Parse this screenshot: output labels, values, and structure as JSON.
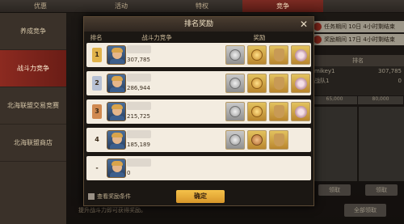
{
  "top_tabs": [
    {
      "label": "优惠"
    },
    {
      "label": "活动"
    },
    {
      "label": "特权"
    },
    {
      "label": "竞争",
      "active": true
    },
    {
      "label": ""
    }
  ],
  "sidebar": {
    "items": [
      {
        "label": "养成竞争"
      },
      {
        "label": "战斗力竞争",
        "active": true
      },
      {
        "label": "北海联盟交易竞赛"
      },
      {
        "label": "北海联盟商店"
      }
    ]
  },
  "bg": {
    "task_period_label": "任务期间",
    "task_period_value": "10日 4小时剩结束",
    "reward_period_label": "奖励期间",
    "reward_period_value": "17日 4小时剩结束",
    "rank_header": "排名",
    "rank_lines": [
      {
        "name": "mikey1",
        "value": "307,785"
      },
      {
        "name": "战队1",
        "value": "0"
      }
    ],
    "grid_values": [
      "65,000",
      "80,000"
    ],
    "claim_buttons": [
      "领取",
      "领取"
    ],
    "claim_all": "全部领取",
    "bottom_hint": "提升战斗力即可获得奖励。"
  },
  "modal": {
    "title": "排名奖励",
    "close_icon": "close-icon",
    "columns": {
      "rank": "排名",
      "power": "战斗力竞争",
      "reward": "奖励"
    },
    "rows": [
      {
        "rank": "1",
        "badge": "r1",
        "power": "307,785",
        "rewards": [
          {
            "type": "c-silver",
            "frame": "silver"
          },
          {
            "type": "c-gold",
            "frame": "gold"
          },
          {
            "type": "pot",
            "frame": "gold"
          },
          {
            "type": "flower",
            "frame": "gold"
          }
        ]
      },
      {
        "rank": "2",
        "badge": "r2",
        "power": "286,944",
        "rewards": [
          {
            "type": "c-silver",
            "frame": "silver"
          },
          {
            "type": "c-gold",
            "frame": "gold"
          },
          {
            "type": "pot",
            "frame": "gold"
          },
          {
            "type": "flower",
            "frame": "gold"
          }
        ]
      },
      {
        "rank": "3",
        "badge": "r3",
        "power": "215,725",
        "rewards": [
          {
            "type": "c-silver",
            "frame": "silver"
          },
          {
            "type": "c-gold",
            "frame": "gold"
          },
          {
            "type": "pot",
            "frame": "gold"
          },
          {
            "type": "flower",
            "frame": "gold"
          }
        ]
      },
      {
        "rank": "4",
        "badge": "plain",
        "power": "185,189",
        "rewards": [
          {
            "type": "c-silver",
            "frame": "silver"
          },
          {
            "type": "c-bronze",
            "frame": "gold"
          },
          {
            "type": "pot",
            "frame": "gold"
          }
        ]
      },
      {
        "rank": "-",
        "badge": "plain",
        "power": "0",
        "rewards": []
      }
    ],
    "checkbox_label": "查看奖励条件",
    "confirm_label": "确定"
  }
}
